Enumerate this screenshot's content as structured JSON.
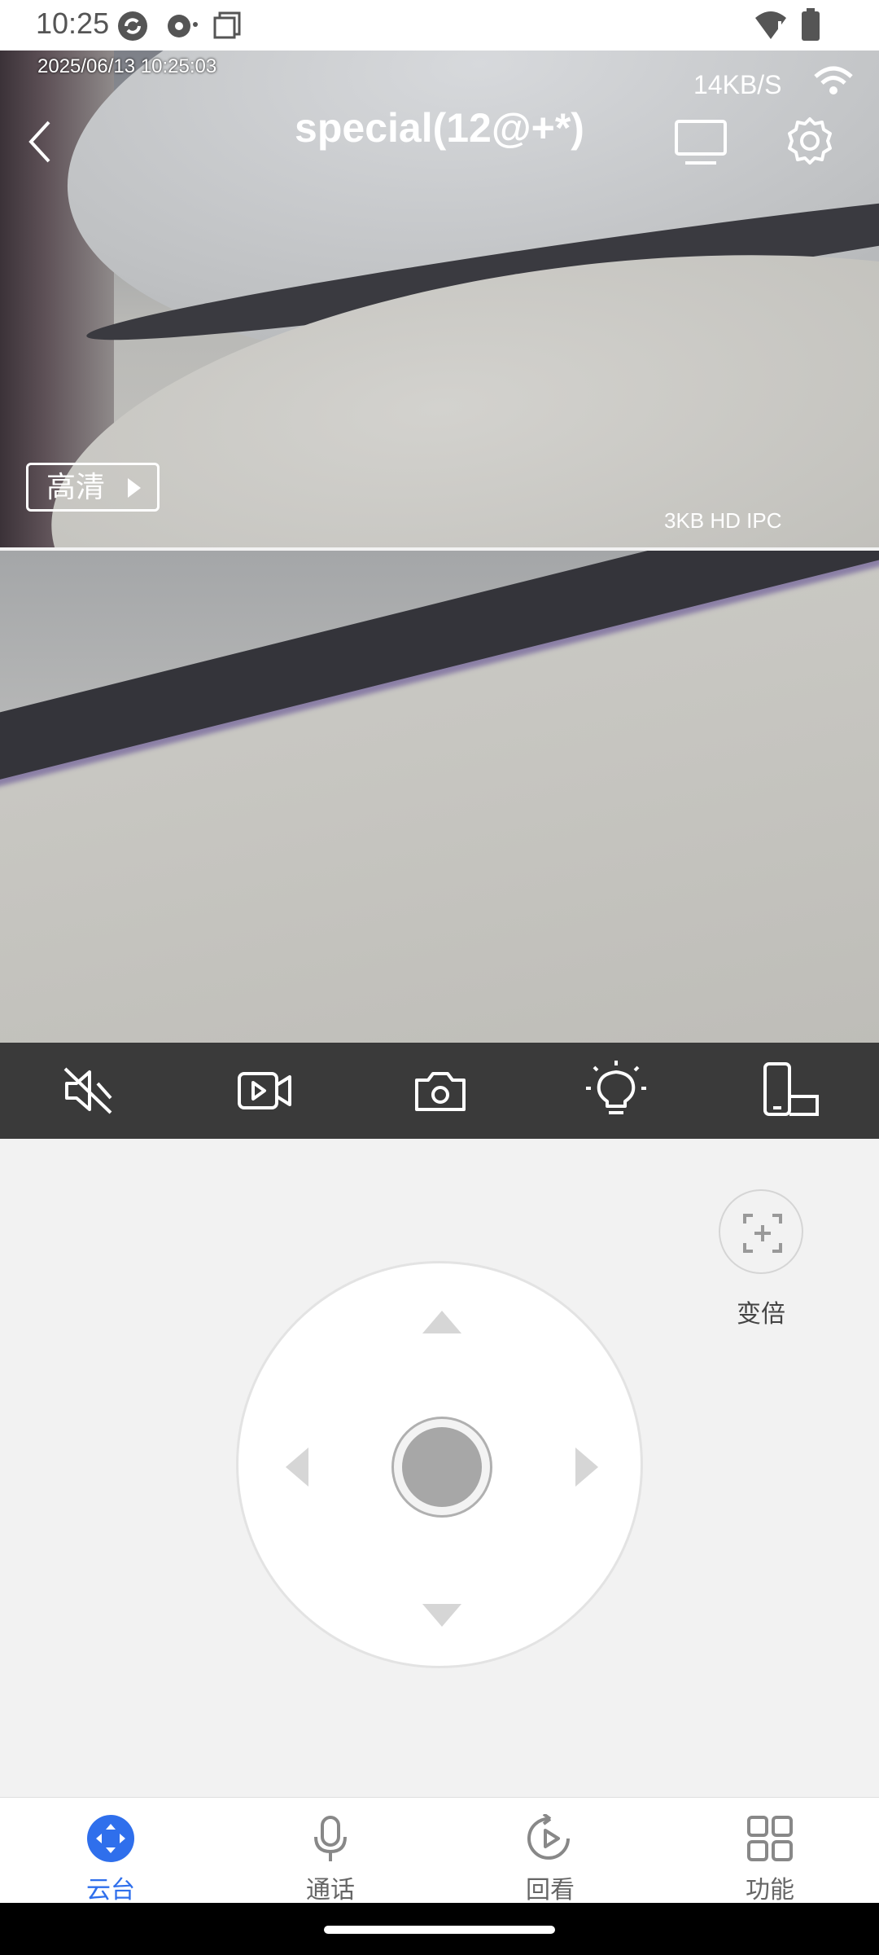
{
  "status_bar": {
    "time": "10:25"
  },
  "video": {
    "timestamp": "2025/06/13 10:25:03",
    "speed": "14KB/S",
    "title": "special(12@+*)",
    "quality_label": "高清",
    "ipc_overlay": "3KB HD IPC"
  },
  "toolbar": {
    "items": [
      "mute-icon",
      "record-video-icon",
      "snapshot-icon",
      "light-icon",
      "screen-orientation-icon"
    ]
  },
  "ptz": {
    "zoom_label": "变倍"
  },
  "bottom_nav": {
    "items": [
      {
        "label": "云台",
        "icon": "ptz-icon",
        "active": true
      },
      {
        "label": "通话",
        "icon": "microphone-icon",
        "active": false
      },
      {
        "label": "回看",
        "icon": "playback-icon",
        "active": false
      },
      {
        "label": "功能",
        "icon": "grid-icon",
        "active": false
      }
    ]
  },
  "colors": {
    "accent": "#2f6fec",
    "toolbar": "#3a3a3a"
  }
}
